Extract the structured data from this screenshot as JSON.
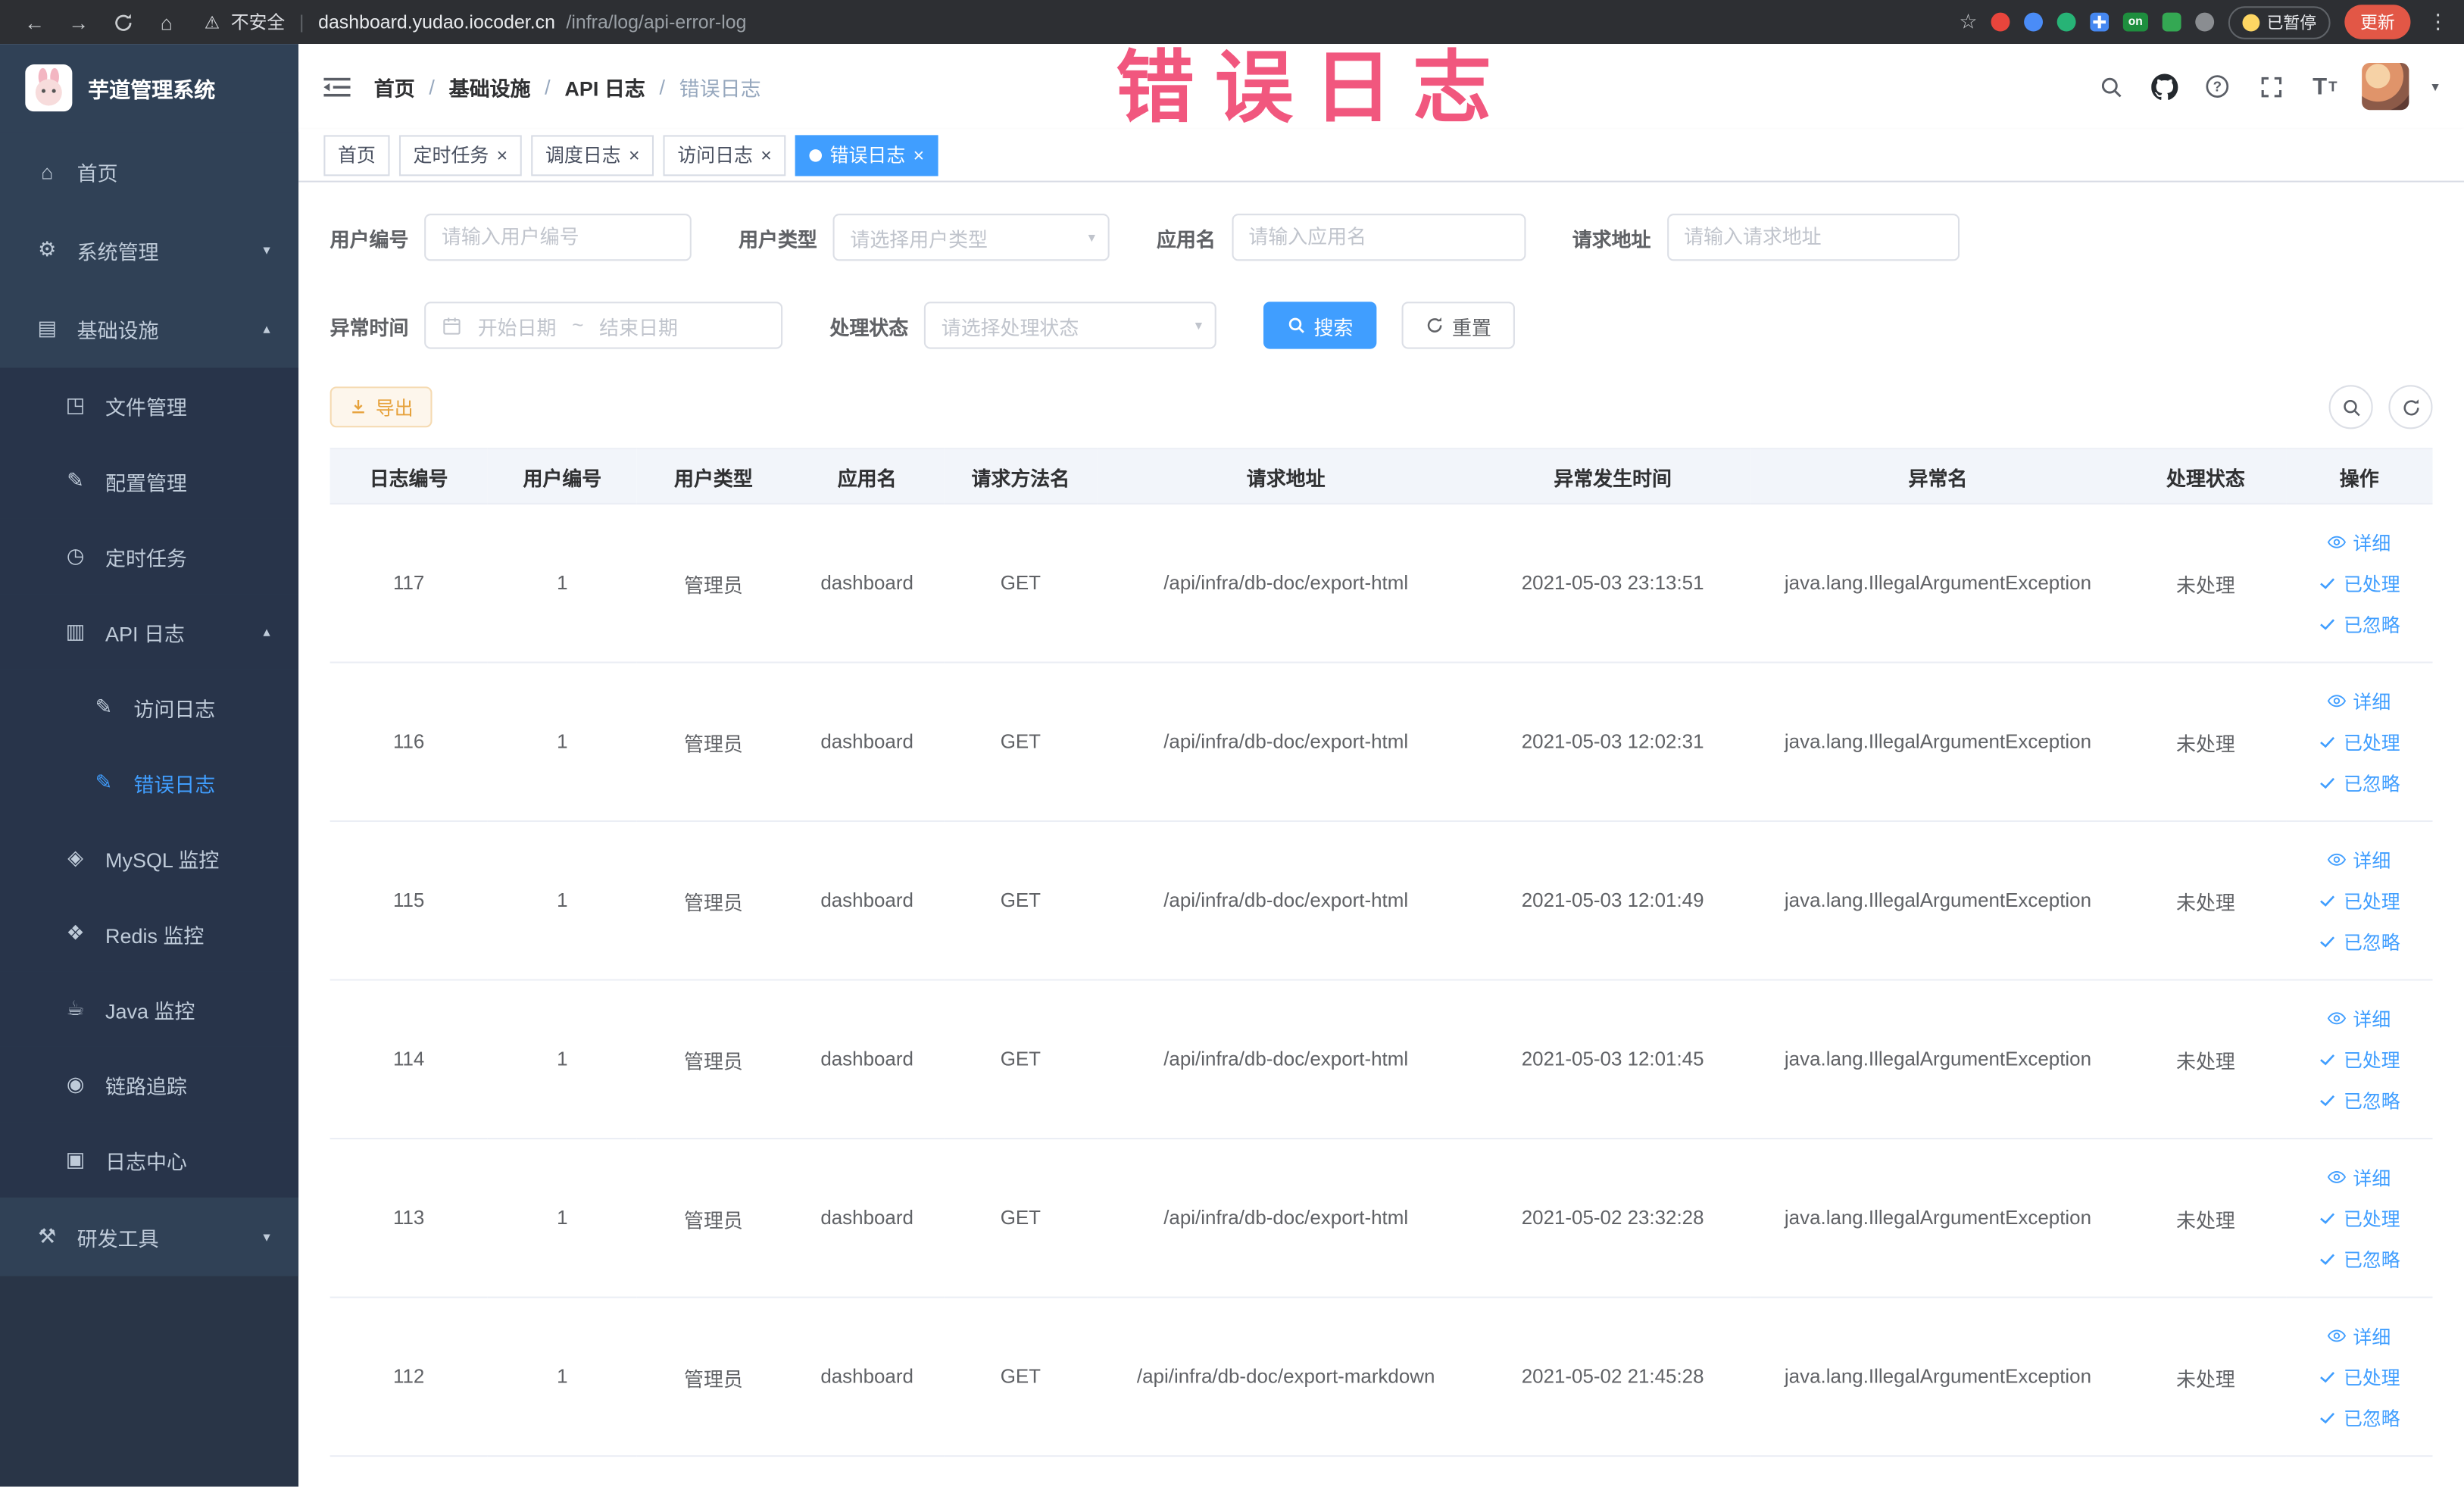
{
  "browser": {
    "security_label": "不安全",
    "url_host": "dashboard.yudao.iocoder.cn",
    "url_path": "/infra/log/api-error-log",
    "extension_badge": "on",
    "paused_badge": "已暂停",
    "update_button": "更新"
  },
  "watermark": "错误日志",
  "sidebar": {
    "logo_title": "芋道管理系统",
    "menu": [
      {
        "key": "home",
        "label": "首页",
        "icon": "home-icon",
        "level": 1
      },
      {
        "key": "system-management",
        "label": "系统管理",
        "icon": "gear-icon",
        "level": 1,
        "arrow": "down"
      },
      {
        "key": "infrastructure",
        "label": "基础设施",
        "icon": "monitor-icon",
        "level": 1,
        "arrow": "up"
      },
      {
        "key": "file-management",
        "label": "文件管理",
        "icon": "file-icon",
        "level": 2
      },
      {
        "key": "config-management",
        "label": "配置管理",
        "icon": "edit-icon",
        "level": 2
      },
      {
        "key": "scheduled-tasks",
        "label": "定时任务",
        "icon": "timer-icon",
        "level": 2
      },
      {
        "key": "api-logs",
        "label": "API 日志",
        "icon": "api-log-icon",
        "level": 2,
        "arrow": "up"
      },
      {
        "key": "access-log",
        "label": "访问日志",
        "icon": "doc-edit-icon",
        "level": 3
      },
      {
        "key": "error-log",
        "label": "错误日志",
        "icon": "doc-edit-icon",
        "level": 3,
        "active": true
      },
      {
        "key": "mysql-monitor",
        "label": "MySQL 监控",
        "icon": "mysql-icon",
        "level": 2
      },
      {
        "key": "redis-monitor",
        "label": "Redis 监控",
        "icon": "redis-icon",
        "level": 2
      },
      {
        "key": "java-monitor",
        "label": "Java 监控",
        "icon": "java-icon",
        "level": 2
      },
      {
        "key": "link-tracing",
        "label": "链路追踪",
        "icon": "trace-icon",
        "level": 2
      },
      {
        "key": "log-center",
        "label": "日志中心",
        "icon": "log-center-icon",
        "level": 2
      },
      {
        "key": "dev-tools",
        "label": "研发工具",
        "icon": "tools-icon",
        "level": 1,
        "arrow": "down"
      }
    ]
  },
  "header": {
    "breadcrumb": [
      "首页",
      "基础设施",
      "API 日志",
      "错误日志"
    ]
  },
  "tabs": [
    {
      "key": "home",
      "label": "首页",
      "closable": false,
      "active": false
    },
    {
      "key": "scheduled-tasks",
      "label": "定时任务",
      "closable": true,
      "active": false
    },
    {
      "key": "schedule-log",
      "label": "调度日志",
      "closable": true,
      "active": false
    },
    {
      "key": "access-log",
      "label": "访问日志",
      "closable": true,
      "active": false
    },
    {
      "key": "error-log",
      "label": "错误日志",
      "closable": true,
      "active": true
    }
  ],
  "filters": {
    "user_id": {
      "label": "用户编号",
      "placeholder": "请输入用户编号"
    },
    "user_type": {
      "label": "用户类型",
      "placeholder": "请选择用户类型"
    },
    "app_name": {
      "label": "应用名",
      "placeholder": "请输入应用名"
    },
    "request_url": {
      "label": "请求地址",
      "placeholder": "请输入请求地址"
    },
    "exception_time": {
      "label": "异常时间",
      "start_placeholder": "开始日期",
      "separator": "~",
      "end_placeholder": "结束日期"
    },
    "process_status": {
      "label": "处理状态",
      "placeholder": "请选择处理状态"
    },
    "search_button": "搜索",
    "reset_button": "重置"
  },
  "toolbar": {
    "export_label": "导出"
  },
  "table": {
    "columns": [
      "日志编号",
      "用户编号",
      "用户类型",
      "应用名",
      "请求方法名",
      "请求地址",
      "异常发生时间",
      "异常名",
      "处理状态",
      "操作"
    ],
    "rows": [
      {
        "id": "117",
        "user_id": "1",
        "user_type": "管理员",
        "app_name": "dashboard",
        "method": "GET",
        "url": "/api/infra/db-doc/export-html",
        "time": "2021-05-03 23:13:51",
        "exception": "java.lang.IllegalArgumentException",
        "status": "未处理"
      },
      {
        "id": "116",
        "user_id": "1",
        "user_type": "管理员",
        "app_name": "dashboard",
        "method": "GET",
        "url": "/api/infra/db-doc/export-html",
        "time": "2021-05-03 12:02:31",
        "exception": "java.lang.IllegalArgumentException",
        "status": "未处理"
      },
      {
        "id": "115",
        "user_id": "1",
        "user_type": "管理员",
        "app_name": "dashboard",
        "method": "GET",
        "url": "/api/infra/db-doc/export-html",
        "time": "2021-05-03 12:01:49",
        "exception": "java.lang.IllegalArgumentException",
        "status": "未处理"
      },
      {
        "id": "114",
        "user_id": "1",
        "user_type": "管理员",
        "app_name": "dashboard",
        "method": "GET",
        "url": "/api/infra/db-doc/export-html",
        "time": "2021-05-03 12:01:45",
        "exception": "java.lang.IllegalArgumentException",
        "status": "未处理"
      },
      {
        "id": "113",
        "user_id": "1",
        "user_type": "管理员",
        "app_name": "dashboard",
        "method": "GET",
        "url": "/api/infra/db-doc/export-html",
        "time": "2021-05-02 23:32:28",
        "exception": "java.lang.IllegalArgumentException",
        "status": "未处理"
      },
      {
        "id": "112",
        "user_id": "1",
        "user_type": "管理员",
        "app_name": "dashboard",
        "method": "GET",
        "url": "/api/infra/db-doc/export-markdown",
        "time": "2021-05-02 21:45:28",
        "exception": "java.lang.IllegalArgumentException",
        "status": "未处理"
      }
    ],
    "row_actions": [
      "详细",
      "已处理",
      "已忽略"
    ]
  },
  "colors": {
    "primary": "#409eff",
    "warning": "#e6a23c",
    "sidebar_bg": "#304156",
    "watermark_pink": "#f14f78"
  }
}
